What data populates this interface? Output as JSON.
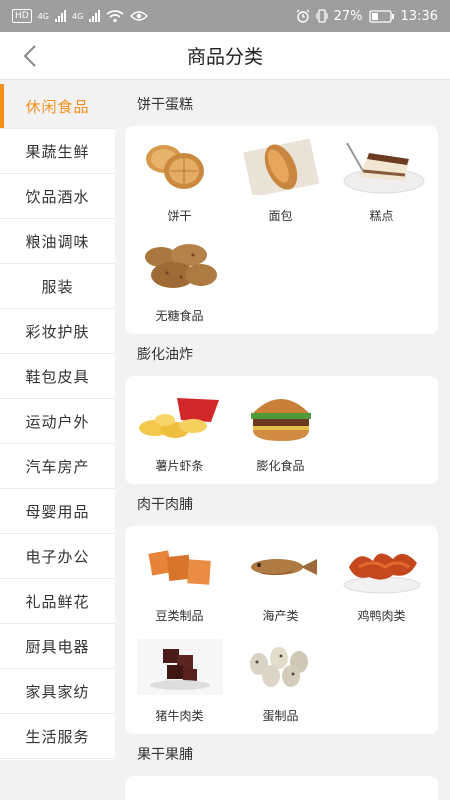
{
  "statusbar": {
    "hd": "HD",
    "net1": "4G",
    "net2": "4G",
    "battery": "27%",
    "time": "13:36"
  },
  "header": {
    "title": "商品分类"
  },
  "sidebar": {
    "items": [
      "休闲食品",
      "果蔬生鲜",
      "饮品酒水",
      "粮油调味",
      "服装",
      "彩妆护肤",
      "鞋包皮具",
      "运动户外",
      "汽车房产",
      "母婴用品",
      "电子办公",
      "礼品鲜花",
      "厨具电器",
      "家具家纺",
      "生活服务"
    ]
  },
  "sections": [
    {
      "title": "饼干蛋糕",
      "items": [
        "饼干",
        "面包",
        "糕点",
        "无糖食品"
      ]
    },
    {
      "title": "膨化油炸",
      "items": [
        "薯片虾条",
        "膨化食品"
      ]
    },
    {
      "title": "肉干肉脯",
      "items": [
        "豆类制品",
        "海产类",
        "鸡鸭肉类",
        "猪牛肉类",
        "蛋制品"
      ]
    },
    {
      "title": "果干果脯",
      "items": []
    }
  ],
  "accent": "#f4901e"
}
